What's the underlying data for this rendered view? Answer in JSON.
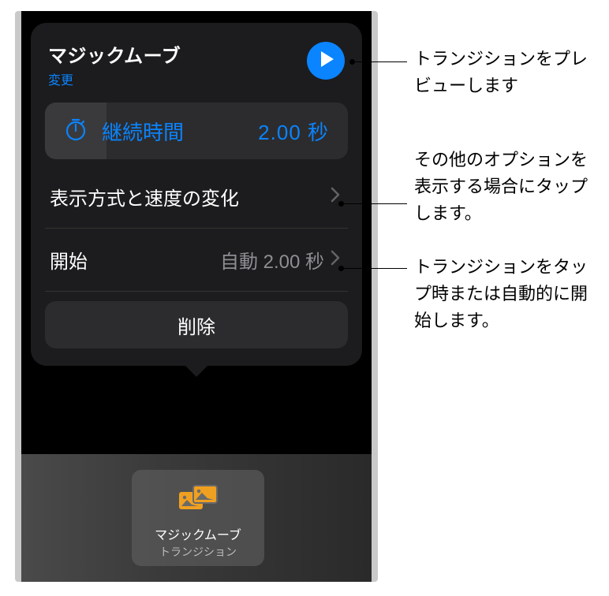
{
  "popover": {
    "title": "マジックムーブ",
    "change": "変更",
    "duration": {
      "label": "継続時間",
      "value": "2.00 秒"
    },
    "delivery_row": {
      "label": "表示方式と速度の変化"
    },
    "start_row": {
      "label": "開始",
      "value": "自動 2.00 秒"
    },
    "delete": "削除"
  },
  "thumbnail": {
    "title": "マジックムーブ",
    "subtitle": "トランジション"
  },
  "callouts": {
    "preview": "トランジションをプレビューします",
    "options": "その他のオプションを表示する場合にタップします。",
    "start": "トランジションをタップ時または自動的に開始します。"
  }
}
